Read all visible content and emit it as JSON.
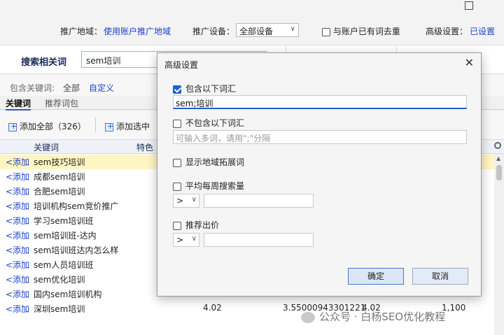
{
  "topbar": {
    "region_label": "推广地域：",
    "region_value": "使用账户推广地域",
    "device_label": "推广设备：",
    "device_value": "全部设备",
    "dedupe_label": "与账户已有词去重",
    "advanced_label": "高级设置：",
    "advanced_value": "已设置"
  },
  "search": {
    "title": "搜索相关词",
    "value": "sem培训"
  },
  "filter": {
    "label": "包含关键词:",
    "all": "全部",
    "custom": "自定义"
  },
  "tabs": [
    {
      "label": "关键词"
    },
    {
      "label": "推荐词包"
    }
  ],
  "toolbar": {
    "add_all": "添加全部（326）",
    "add_selected": "添加选中"
  },
  "grid": {
    "headers": [
      "关键词",
      "特色"
    ],
    "add_label": "<添加",
    "rows": [
      {
        "kw": "sem技巧培训"
      },
      {
        "kw": "成都sem培训"
      },
      {
        "kw": "合肥sem培训"
      },
      {
        "kw": "培训机构sem竞价推广"
      },
      {
        "kw": "学习sem培训班"
      },
      {
        "kw": "sem培训班-达内"
      },
      {
        "kw": "sem培训班达内怎么样"
      },
      {
        "kw": "sem人员培训班"
      },
      {
        "kw": "sem优化培训"
      },
      {
        "kw": "国内sem培训机构"
      },
      {
        "kw": "深圳sem培训",
        "c1": "4.02",
        "c2": "3.55000943301221",
        "c3": "4.02",
        "c4": "1,100"
      }
    ]
  },
  "dialog": {
    "title": "高级设置",
    "include_label": "包含以下词汇",
    "include_value": "sem;培训",
    "exclude_label": "不包含以下词汇",
    "exclude_placeholder": "可输入多词，请用\";\"分隔",
    "region_label": "显示地域拓展词",
    "avg_search_label": "平均每周搜索量",
    "avg_op": ">",
    "bid_label": "推荐出价",
    "bid_op": ">",
    "ok": "确定",
    "cancel": "取消"
  },
  "watermark": {
    "text": "公众号 · 白杨SEO优化教程"
  }
}
